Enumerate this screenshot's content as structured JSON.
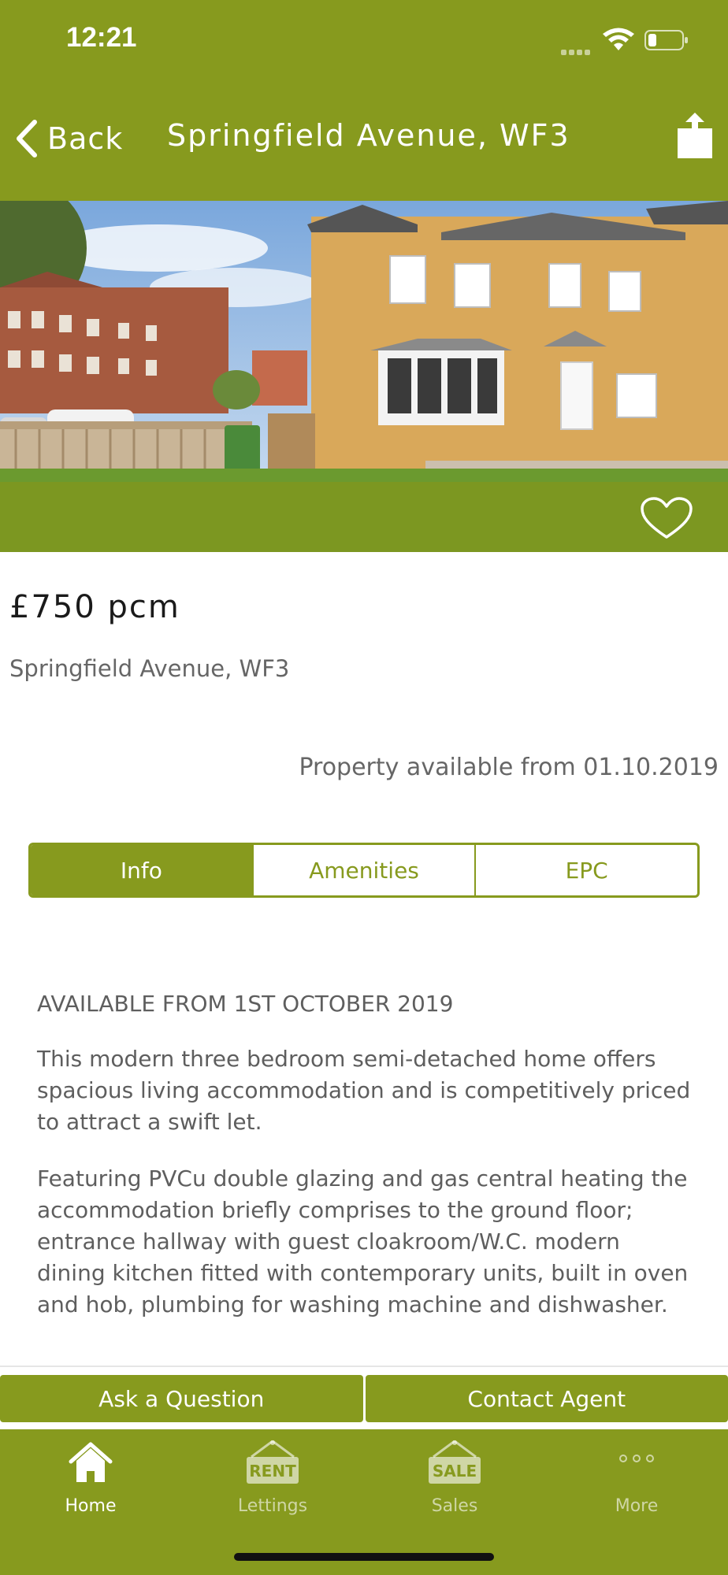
{
  "status_bar": {
    "time": "12:21"
  },
  "nav": {
    "back_label": "Back",
    "title": "Springfield Avenue, WF3"
  },
  "listing": {
    "price": "£750 pcm",
    "address": "Springfield Avenue, WF3",
    "availability": "Property available from 01.10.2019"
  },
  "tabs": [
    {
      "label": "Info",
      "active": true
    },
    {
      "label": "Amenities",
      "active": false
    },
    {
      "label": "EPC",
      "active": false
    }
  ],
  "description": {
    "headline": "AVAILABLE FROM 1ST OCTOBER 2019",
    "paragraphs": [
      "This modern three bedroom semi-detached home offers spacious living accommodation and is competitively priced to attract a swift let.",
      "Featuring PVCu double glazing and gas central heating the accommodation briefly comprises to the ground floor; entrance hallway with guest cloakroom/W.C. modern dining kitchen fitted with contemporary units, built in oven and hob, plumbing for washing machine and dishwasher."
    ]
  },
  "actions": {
    "ask_label": "Ask a Question",
    "contact_label": "Contact Agent"
  },
  "tabbar": {
    "items": [
      {
        "label": "Home",
        "icon": "home-icon",
        "active": true
      },
      {
        "label": "Lettings",
        "icon": "rent-sign-icon",
        "sign_text": "RENT",
        "active": false
      },
      {
        "label": "Sales",
        "icon": "sale-sign-icon",
        "sign_text": "SALE",
        "active": false
      },
      {
        "label": "More",
        "icon": "more-dots-icon",
        "active": false
      }
    ]
  },
  "colors": {
    "brand": "#879a1e",
    "overlay": "#80961e",
    "text": "#5e5e5e"
  }
}
